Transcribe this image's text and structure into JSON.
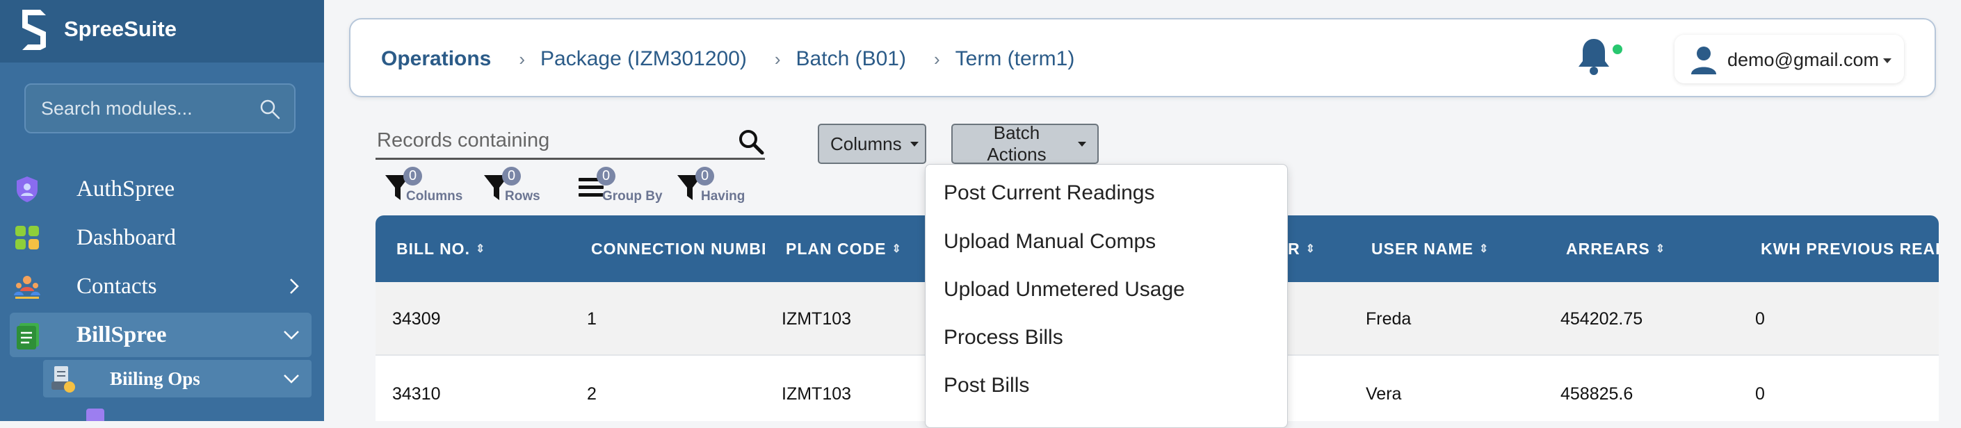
{
  "app": {
    "name": "SpreeSuite"
  },
  "sidebar": {
    "search_placeholder": "Search modules...",
    "items": [
      {
        "label": "AuthSpree",
        "icon": "shield-user-icon"
      },
      {
        "label": "Dashboard",
        "icon": "dashboard-icon"
      },
      {
        "label": "Contacts",
        "icon": "contacts-icon",
        "chevron": "right"
      },
      {
        "label": "BillSpree",
        "icon": "bill-icon",
        "chevron": "down",
        "active": true
      },
      {
        "label": "Biiling Ops",
        "icon": "billing-ops-icon",
        "chevron": "down",
        "sub": true
      }
    ]
  },
  "header": {
    "breadcrumb": {
      "root": "Operations",
      "items": [
        "Package (IZM301200)",
        "Batch (B01)",
        "Term (term1)"
      ]
    },
    "notification_dot_color": "#28c76f",
    "user_email": "demo@gmail.com"
  },
  "toolbar": {
    "search_placeholder": "Records containing",
    "columns_label": "Columns",
    "batch_actions_label": "Batch Actions",
    "filters": [
      {
        "label": "Columns",
        "count": "0",
        "icon": "filter-icon"
      },
      {
        "label": "Rows",
        "count": "0",
        "icon": "filter-icon"
      },
      {
        "label": "Group By",
        "count": "0",
        "icon": "group-by-icon"
      },
      {
        "label": "Having",
        "count": "0",
        "icon": "filter-icon"
      }
    ]
  },
  "table": {
    "columns": [
      "BILL NO.",
      "CONNECTION NUMBER",
      "PLAN CODE",
      "R",
      "USER NAME",
      "ARREARS",
      "KWH PREVIOUS READING"
    ],
    "rows": [
      [
        "34309",
        "1",
        "IZMT103",
        "Freda",
        "454202.75",
        "0"
      ],
      [
        "34310",
        "2",
        "IZMT103",
        "Vera",
        "458825.6",
        "0"
      ]
    ]
  },
  "batch_actions_menu": {
    "items": [
      "Post Current Readings",
      "Upload Manual Comps",
      "Upload Unmetered Usage",
      "Process Bills",
      "Post Bills"
    ]
  },
  "colors": {
    "sidebar_bg": "#3a6e9d",
    "brand_bg": "#2d5d88",
    "table_header_bg": "#2f6495",
    "breadcrumb_text": "#2b5b88"
  }
}
